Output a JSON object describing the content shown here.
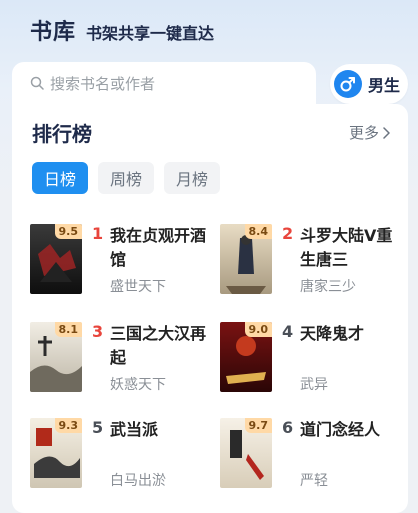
{
  "header": {
    "brand": "书库",
    "slogan": "书架共享一键直达"
  },
  "search": {
    "placeholder": "搜索书名或作者",
    "icon": "search-icon"
  },
  "gender": {
    "label": "男生",
    "icon": "male-icon",
    "color": "#1f86ef"
  },
  "ranking": {
    "title": "排行榜",
    "more_label": "更多",
    "tabs": [
      {
        "label": "日榜",
        "active": true
      },
      {
        "label": "周榜",
        "active": false
      },
      {
        "label": "月榜",
        "active": false
      }
    ],
    "books": [
      {
        "rank": "1",
        "title": "我在贞观开酒馆",
        "author": "盛世天下",
        "score": "9.5",
        "rank_color": "#e8453c"
      },
      {
        "rank": "2",
        "title": "斗罗大陆V重生唐三",
        "author": "唐家三少",
        "score": "8.4",
        "rank_color": "#e8453c"
      },
      {
        "rank": "3",
        "title": "三国之大汉再起",
        "author": "妖惑天下",
        "score": "8.1",
        "rank_color": "#e8453c"
      },
      {
        "rank": "4",
        "title": "天降鬼才",
        "author": "武异",
        "score": "9.0",
        "rank_color": "#4a4f57"
      },
      {
        "rank": "5",
        "title": "武当派",
        "author": "白马出淤",
        "score": "9.3",
        "rank_color": "#4a4f57"
      },
      {
        "rank": "6",
        "title": "道门念经人",
        "author": "严轻",
        "score": "9.7",
        "rank_color": "#4a4f57"
      }
    ]
  },
  "colors": {
    "accent": "#1f8ff0",
    "rank_top": "#e8453c",
    "rank_other": "#4a4f57",
    "badge_bg": "#ffd9a6"
  }
}
